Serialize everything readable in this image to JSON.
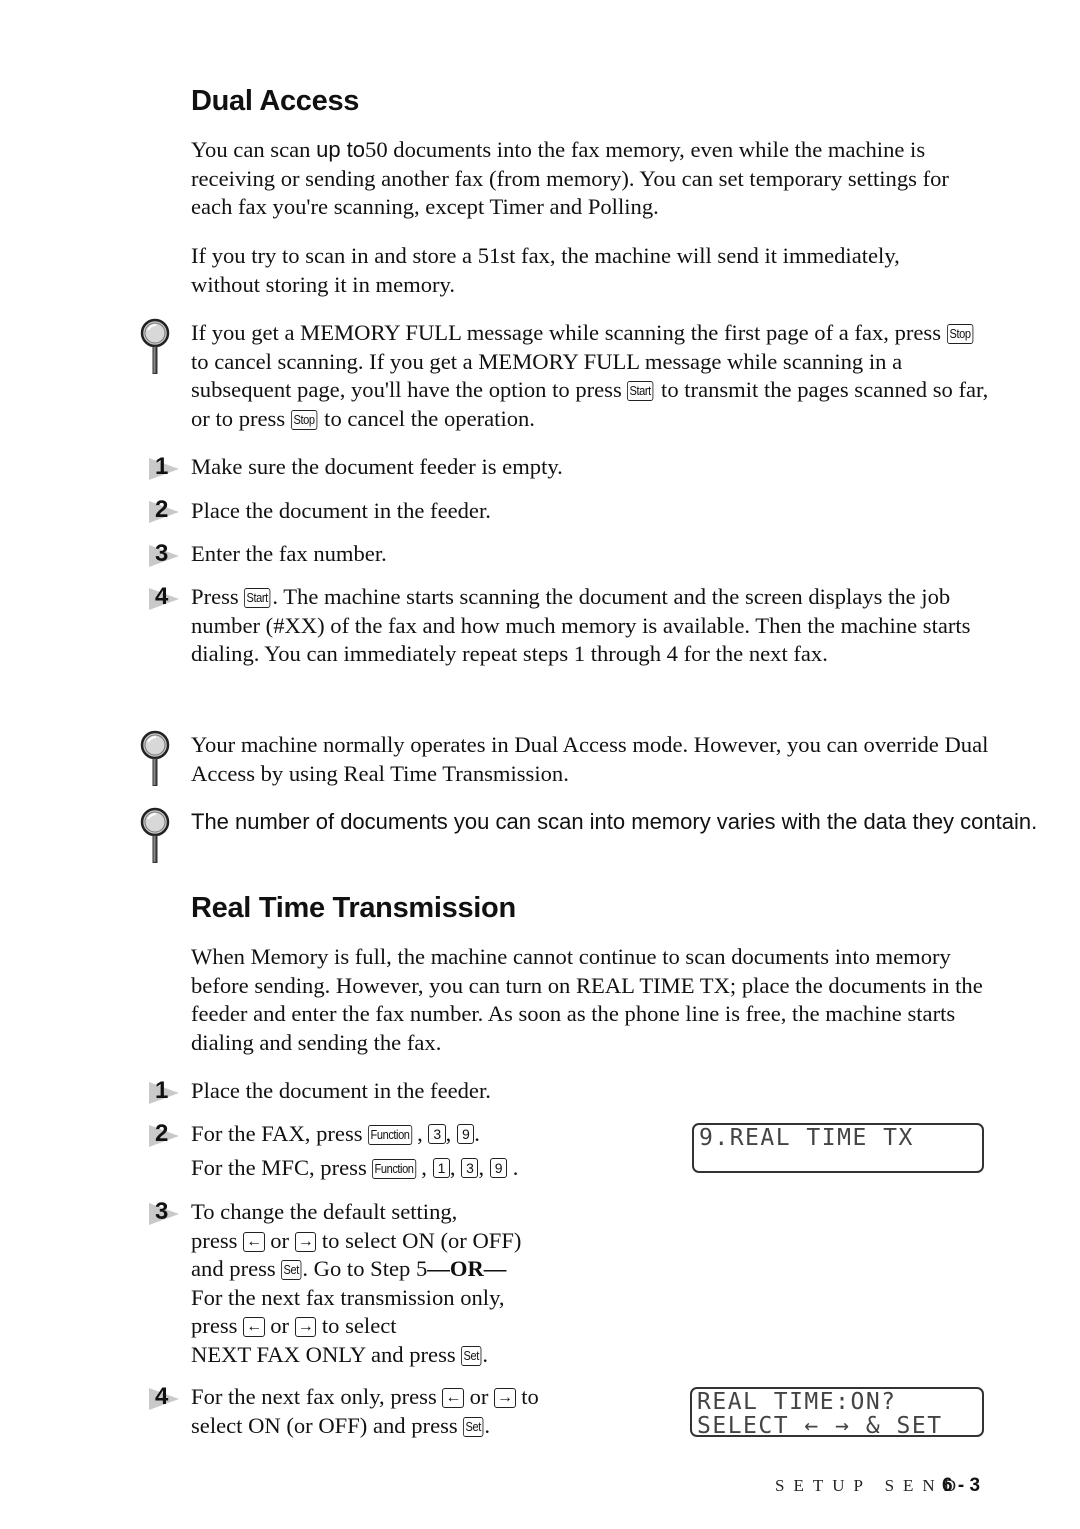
{
  "sections": {
    "dual_access": {
      "title": "Dual Access",
      "para1_a": "You can scan ",
      "para1_b": "up to",
      "para1_c": "50 documents into the fax memory, even while the machine is receiving or sending another fax (from memory). You can set temporary settings for each fax you're scanning, except Timer and Polling.",
      "para2": "If you try to scan in and store a 51st fax, the machine will send it immediately, without storing it in memory.",
      "note1": {
        "t1": "If you get a MEMORY FULL message while scanning the first page of a fax, press ",
        "k1": "Stop",
        "t2": " to cancel scanning.  If you get a MEMORY FULL message while scanning in a subsequent page, you'll have the option to press ",
        "k2": "Start",
        "t3": " to transmit the pages scanned so far, or to press ",
        "k3": "Stop",
        "t4": " to cancel the operation."
      },
      "steps": [
        {
          "num": "1",
          "text": "Make sure the document feeder is empty."
        },
        {
          "num": "2",
          "text": "Place the document in the feeder."
        },
        {
          "num": "3",
          "text": "Enter the fax number."
        },
        {
          "num": "4",
          "t1": "Press ",
          "key": "Start",
          "t2": ".  The machine starts scanning the document and the screen displays the job number (#XX) of the fax and how much memory is available. Then the machine starts dialing.  You can immediately repeat steps 1 through 4 for the next fax."
        }
      ],
      "note2": "Your machine normally operates in Dual Access mode.  However, you can override Dual Access by using Real Time Transmission.",
      "note3": "The number of documents you can scan into memory varies with the data they contain."
    },
    "real_time": {
      "title": "Real Time Transmission",
      "para1": "When Memory is full, the machine cannot continue to scan documents into memory before sending.  However, you can turn on REAL TIME TX; place the documents in the feeder and enter the fax number.  As soon as the phone line is free, the machine starts dialing and sending the fax.",
      "steps": [
        {
          "num": "1",
          "text": "Place the document in the feeder."
        },
        {
          "num": "2",
          "fax_prefix": "For the FAX, press ",
          "fax_keys": [
            "Function",
            "3",
            "9"
          ],
          "mfc_prefix": "For the MFC, press ",
          "mfc_keys": [
            "Function",
            "1",
            "3",
            "9"
          ]
        },
        {
          "num": "3",
          "l1": "To change the default setting,",
          "l2a": "press ",
          "left": "←",
          "or": " or ",
          "right": "→",
          "l2b": " to select ON (or OFF)",
          "l3a": "and press ",
          "set": "Set",
          "l3b": ".  Go to Step 5",
          "or_bold": "—OR—",
          "l4": "For the next fax transmission only,",
          "l5b": " to select",
          "l6a": "NEXT FAX ONLY and press ",
          "l6b": "."
        },
        {
          "num": "4",
          "l1a": "For the next fax only, press ",
          "l1b": " to",
          "l2a": "select ON (or OFF) and press ",
          "l2b": "."
        }
      ],
      "lcd1": {
        "line1": "9.REAL TIME TX",
        "line2": ""
      },
      "lcd2": {
        "line1": "REAL TIME:ON?",
        "line2": "SELECT ← → & SET"
      }
    }
  },
  "footer": {
    "section": "SETUP SEND",
    "page": "6 - 3"
  }
}
